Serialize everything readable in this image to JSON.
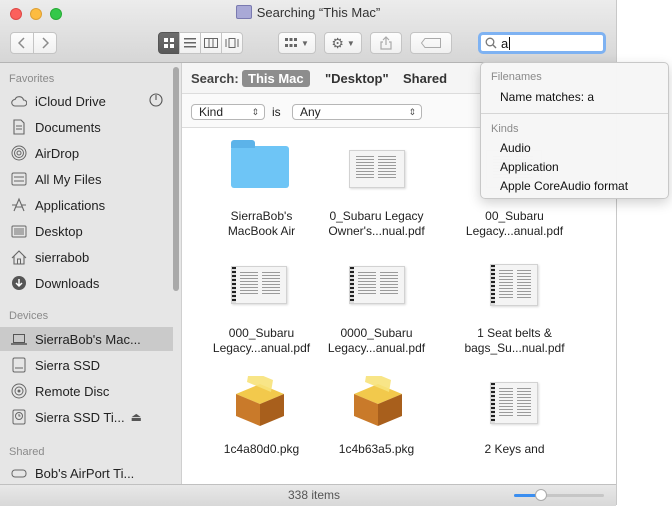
{
  "window": {
    "title": "Searching “This Mac”",
    "search_value": "a"
  },
  "toolbar": {
    "back_icon": "chevron-left-icon",
    "forward_icon": "chevron-right-icon",
    "view_modes": [
      "icon-view",
      "list-view",
      "column-view",
      "cover-flow-view"
    ],
    "active_view": "icon-view",
    "arrange_icon": "arrange-grid-icon",
    "action_icon": "gear-icon",
    "share_icon": "share-icon",
    "tag_icon": "tag-icon"
  },
  "sidebar": {
    "favorites_label": "Favorites",
    "favorites": [
      {
        "label": "iCloud Drive",
        "icon": "cloud-icon"
      },
      {
        "label": "Documents",
        "icon": "documents-icon"
      },
      {
        "label": "AirDrop",
        "icon": "airdrop-icon"
      },
      {
        "label": "All My Files",
        "icon": "all-files-icon"
      },
      {
        "label": "Applications",
        "icon": "applications-icon"
      },
      {
        "label": "Desktop",
        "icon": "desktop-icon"
      },
      {
        "label": "sierrabob",
        "icon": "home-icon"
      },
      {
        "label": "Downloads",
        "icon": "downloads-icon"
      }
    ],
    "devices_label": "Devices",
    "devices": [
      {
        "label": "SierraBob's Mac...",
        "icon": "laptop-icon",
        "selected": true
      },
      {
        "label": "Sierra SSD",
        "icon": "disk-icon"
      },
      {
        "label": "Remote Disc",
        "icon": "optical-disc-icon"
      },
      {
        "label": "Sierra SSD Ti...",
        "icon": "time-machine-disk-icon",
        "eject": "⏏"
      }
    ],
    "shared_label": "Shared",
    "shared": [
      {
        "label": "Bob's AirPort Ti...",
        "icon": "airport-icon"
      }
    ]
  },
  "scope_bar": {
    "label": "Search:",
    "options": [
      "This Mac",
      "\"Desktop\"",
      "Shared"
    ],
    "active": "This Mac"
  },
  "criteria": {
    "attribute": "Kind",
    "operator": "is",
    "value": "Any"
  },
  "files": [
    {
      "name1": "SierraBob's",
      "name2": "MacBook Air",
      "type": "folder"
    },
    {
      "name1": "0_Subaru Legacy",
      "name2": "Owner's...nual.pdf",
      "type": "pdf"
    },
    {
      "name1": "00_Subaru",
      "name2": "Legacy...anual.pdf",
      "type": "pdf"
    },
    {
      "name1": "000_Subaru",
      "name2": "Legacy...anual.pdf",
      "type": "pdf"
    },
    {
      "name1": "0000_Subaru",
      "name2": "Legacy...anual.pdf",
      "type": "pdf"
    },
    {
      "name1": "1 Seat belts &",
      "name2": "bags_Su...nual.pdf",
      "type": "pdf"
    },
    {
      "name1": "1c4a80d0.pkg",
      "name2": "",
      "type": "pkg"
    },
    {
      "name1": "1c4b63a5.pkg",
      "name2": "",
      "type": "pkg"
    },
    {
      "name1": "2 Keys and",
      "name2": "",
      "type": "pdf"
    }
  ],
  "status": {
    "items_text": "338 items",
    "icon_size_level": 0.3
  },
  "suggestions": {
    "filenames_label": "Filenames",
    "filename_items": [
      "Name matches: a"
    ],
    "kinds_label": "Kinds",
    "kind_items": [
      "Audio",
      "Application",
      "Apple CoreAudio format"
    ]
  },
  "colors": {
    "selection_blue": "#3b8ef0",
    "folder_blue": "#6ec5f6",
    "search_focus": "#7eb2f2"
  }
}
